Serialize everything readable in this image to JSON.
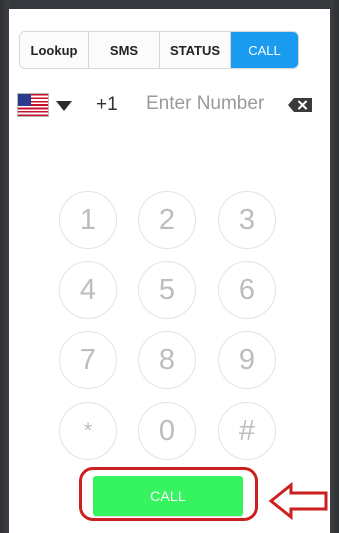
{
  "tabs": [
    {
      "label": "Lookup",
      "active": false
    },
    {
      "label": "SMS",
      "active": false
    },
    {
      "label": "STATUS",
      "active": false
    },
    {
      "label": "CALL",
      "active": true
    }
  ],
  "number_entry": {
    "country_flag": "us-flag-icon",
    "dial_code": "+1",
    "placeholder": "Enter Number",
    "value": ""
  },
  "keypad": {
    "keys": [
      "1",
      "2",
      "3",
      "4",
      "5",
      "6",
      "7",
      "8",
      "9",
      "*",
      "0",
      "#"
    ]
  },
  "call_button": {
    "label": "CALL"
  },
  "colors": {
    "active_tab": "#1a9bf0",
    "call_button": "#35f45f",
    "annotation": "#cc1f1f",
    "key_text": "#bdbdbd",
    "frame": "#35383c"
  }
}
